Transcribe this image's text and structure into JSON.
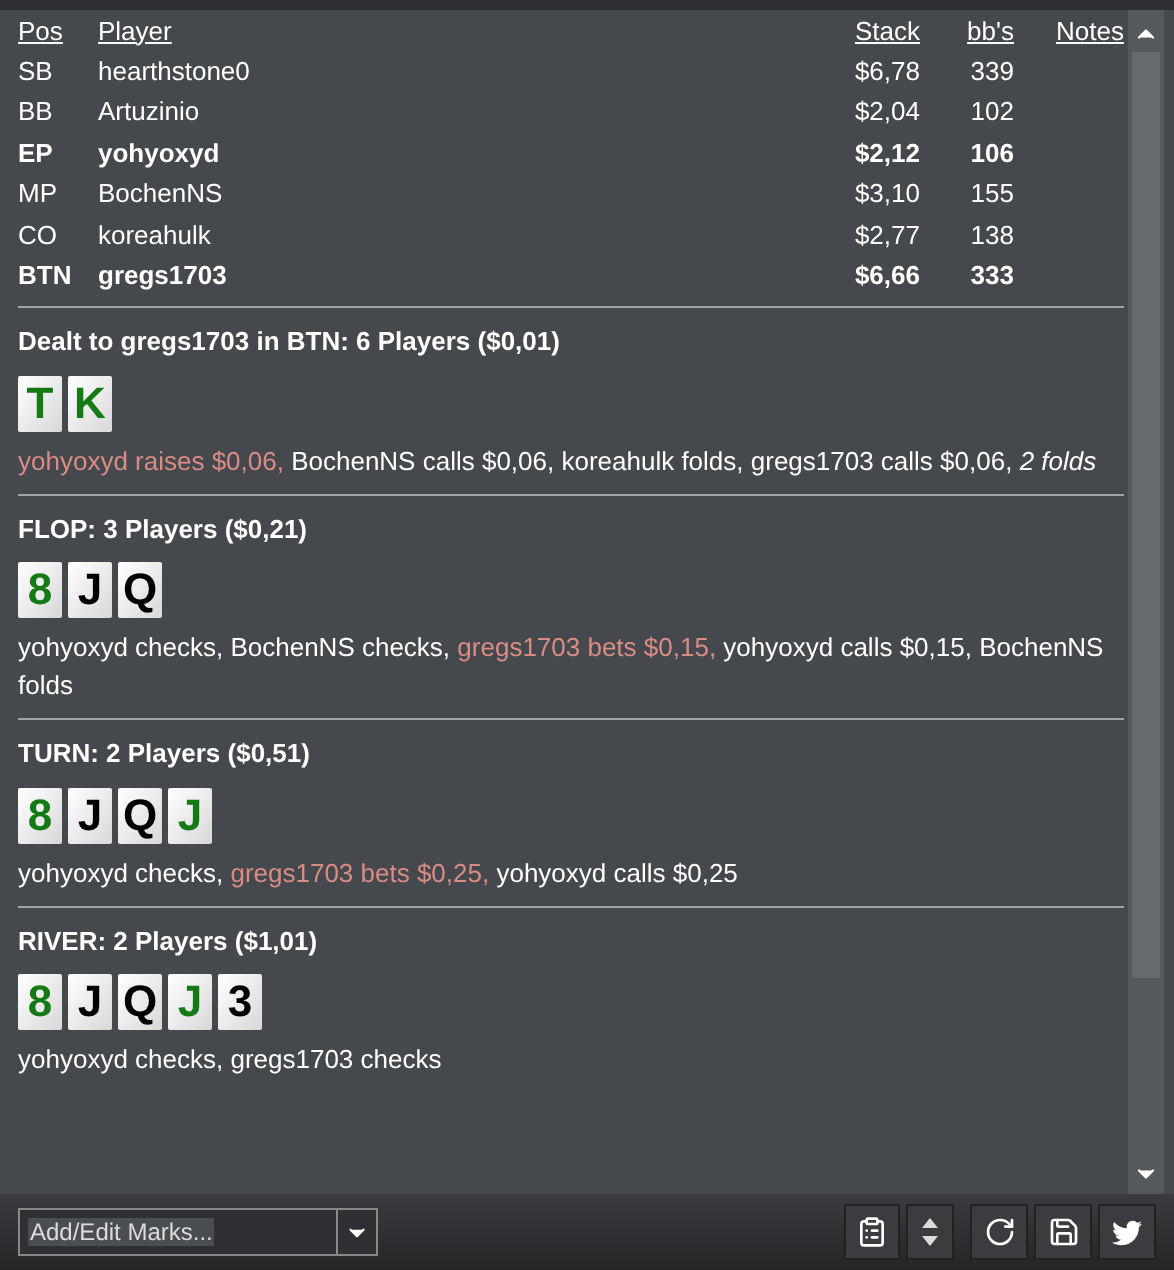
{
  "table": {
    "columns": [
      "Pos",
      "Player",
      "Stack",
      "bb's",
      "Notes"
    ],
    "rows": [
      {
        "pos": "SB",
        "player": "hearthstone0",
        "stack": "$6,78",
        "bbs": "339",
        "highlighted": false
      },
      {
        "pos": "BB",
        "player": "Artuzinio",
        "stack": "$2,04",
        "bbs": "102",
        "highlighted": false
      },
      {
        "pos": "EP",
        "player": "yohyoxyd",
        "stack": "$2,12",
        "bbs": "106",
        "highlighted": true
      },
      {
        "pos": "MP",
        "player": "BochenNS",
        "stack": "$3,10",
        "bbs": "155",
        "highlighted": false
      },
      {
        "pos": "CO",
        "player": "koreahulk",
        "stack": "$2,77",
        "bbs": "138",
        "highlighted": false
      },
      {
        "pos": "BTN",
        "player": "gregs1703",
        "stack": "$6,66",
        "bbs": "333",
        "highlighted": true
      }
    ]
  },
  "streets": [
    {
      "title": "Dealt to gregs1703 in BTN: 6 Players ($0,01)",
      "cards": [
        {
          "rank": "T",
          "color": "#157a15"
        },
        {
          "rank": "K",
          "color": "#157a15"
        }
      ],
      "actions": [
        {
          "kind": "aggressive",
          "text": "yohyoxyd raises $0,06,"
        },
        {
          "kind": "plain",
          "text": "BochenNS calls $0,06, koreahulk folds, gregs1703 calls $0,06,"
        },
        {
          "kind": "italic",
          "text": "2 folds"
        }
      ]
    },
    {
      "title": "FLOP: 3 Players ($0,21)",
      "cards": [
        {
          "rank": "8",
          "color": "#157a15"
        },
        {
          "rank": "J",
          "color": "#000000"
        },
        {
          "rank": "Q",
          "color": "#000000"
        }
      ],
      "actions": [
        {
          "kind": "plain",
          "text": "yohyoxyd checks, BochenNS checks,"
        },
        {
          "kind": "aggressive",
          "text": "gregs1703 bets $0,15,"
        },
        {
          "kind": "plain",
          "text": "yohyoxyd calls $0,15, BochenNS folds"
        }
      ]
    },
    {
      "title": "TURN: 2 Players ($0,51)",
      "cards": [
        {
          "rank": "8",
          "color": "#157a15"
        },
        {
          "rank": "J",
          "color": "#000000"
        },
        {
          "rank": "Q",
          "color": "#000000"
        },
        {
          "rank": "J",
          "color": "#157a15"
        }
      ],
      "actions": [
        {
          "kind": "plain",
          "text": "yohyoxyd checks,"
        },
        {
          "kind": "aggressive",
          "text": "gregs1703 bets $0,25,"
        },
        {
          "kind": "plain",
          "text": "yohyoxyd calls $0,25"
        }
      ]
    },
    {
      "title": "RIVER: 2 Players ($1,01)",
      "cards": [
        {
          "rank": "8",
          "color": "#157a15"
        },
        {
          "rank": "J",
          "color": "#000000"
        },
        {
          "rank": "Q",
          "color": "#000000"
        },
        {
          "rank": "J",
          "color": "#157a15"
        },
        {
          "rank": "3",
          "color": "#000000"
        }
      ],
      "actions": [
        {
          "kind": "plain",
          "text": "yohyoxyd checks, gregs1703 checks"
        }
      ]
    }
  ],
  "toolbar": {
    "marks_dropdown": {
      "value": "Add/Edit Marks..."
    }
  }
}
